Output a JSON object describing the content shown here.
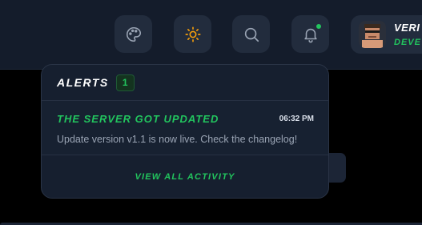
{
  "colors": {
    "accent": "#22c55e",
    "topbar": "#141c2b",
    "panel": "#161f2f",
    "icon_button": "#222c3d"
  },
  "topbar": {
    "icons": [
      "palette-icon",
      "sun-icon",
      "search-icon",
      "bell-icon"
    ],
    "notification_dot": true
  },
  "profile": {
    "name": "VERI",
    "role": "DEVE"
  },
  "alerts": {
    "title": "ALERTS",
    "count": "1",
    "items": [
      {
        "title": "THE SERVER GOT UPDATED",
        "time": "06:32 PM",
        "message": "Update version v1.1 is now live. Check the changelog!"
      }
    ],
    "view_all_label": "VIEW ALL ACTIVITY"
  }
}
